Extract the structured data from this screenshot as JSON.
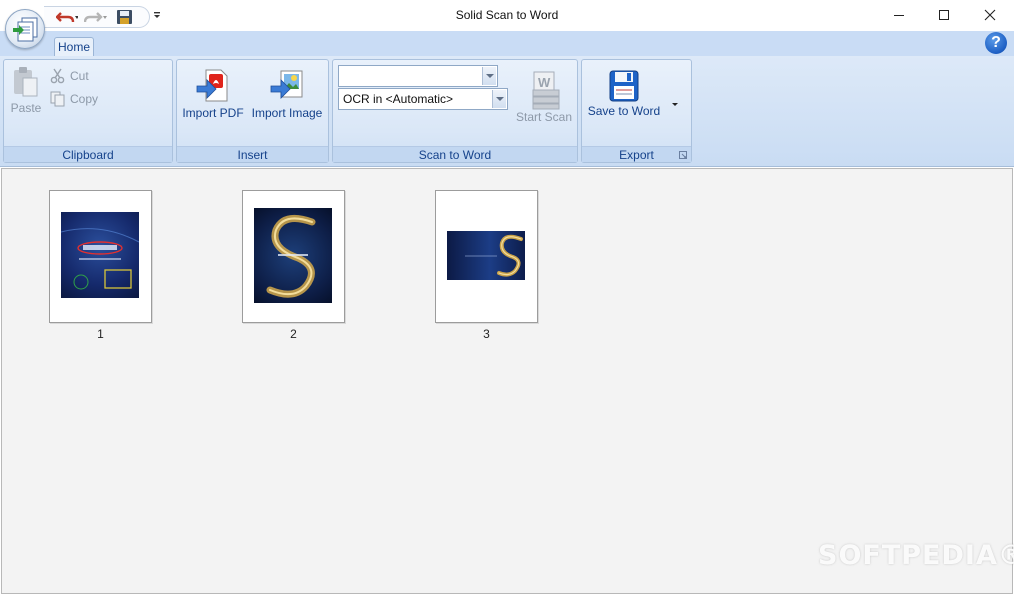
{
  "window": {
    "title": "Solid Scan to Word",
    "minimize_icon": "minimize-icon",
    "maximize_icon": "maximize-icon",
    "close_icon": "close-icon"
  },
  "ribbon": {
    "tabs": [
      {
        "label": "Home",
        "active": true
      }
    ],
    "help_label": "?",
    "clipboard": {
      "label": "Clipboard",
      "paste_label": "Paste",
      "cut_label": "Cut",
      "copy_label": "Copy"
    },
    "insert": {
      "label": "Insert",
      "import_pdf_label": "Import PDF",
      "import_image_label": "Import Image"
    },
    "scan_to_word": {
      "label": "Scan to Word",
      "scanner_value": "",
      "ocr_value": "OCR in <Automatic>",
      "start_scan_label": "Start Scan"
    },
    "export": {
      "label": "Export",
      "save_to_word_label": "Save to Word"
    }
  },
  "pages": [
    {
      "number": "1"
    },
    {
      "number": "2"
    },
    {
      "number": "3"
    }
  ],
  "watermark": "SOFTPEDIA®",
  "colors": {
    "ribbon_text": "#15428b",
    "ribbon_bg": "#dae7f7",
    "workspace_bg": "#f3f3f3"
  }
}
